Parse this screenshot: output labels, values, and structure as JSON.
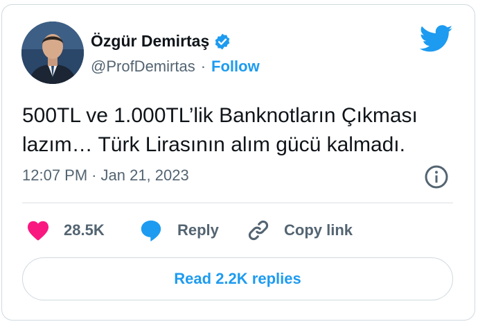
{
  "author": {
    "name": "Özgür Demirtaş",
    "handle": "@ProfDemirtas",
    "separator": "·",
    "follow_label": "Follow"
  },
  "icons": {
    "brand": "twitter-bird-icon",
    "verified": "verified-badge-icon",
    "info": "info-icon",
    "like": "heart-icon",
    "reply": "reply-bubble-icon",
    "copy": "link-icon"
  },
  "tweet": {
    "line1": "500TL ve 1.000TL’lik Banknotların Çıkması",
    "line2": "lazım… Türk Lirasının alım gücü kalmadı.",
    "time": "12:07 PM",
    "separator": "·",
    "date": "Jan 21, 2023"
  },
  "actions": {
    "likes": "28.5K",
    "reply_label": "Reply",
    "copy_label": "Copy link"
  },
  "read_replies_label": "Read 2.2K replies",
  "colors": {
    "accent": "#1d9bf0",
    "like": "#f91880",
    "text": "#0f1419",
    "secondary": "#536471",
    "border": "#cfd9de"
  }
}
